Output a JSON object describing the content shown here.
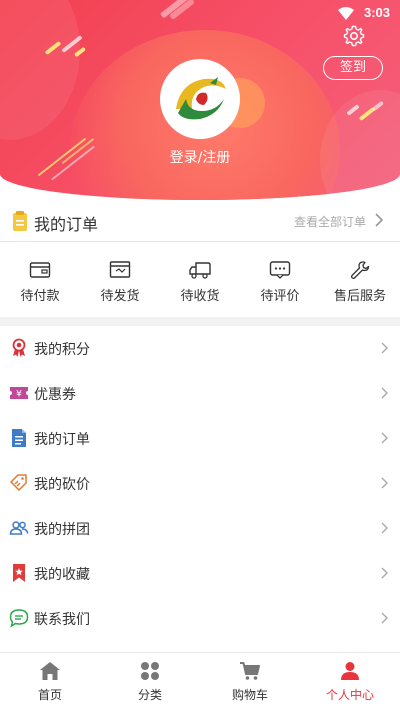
{
  "status_bar": {
    "time": "3:03"
  },
  "header": {
    "checkin_label": "签到",
    "login_label": "登录/注册"
  },
  "orders": {
    "title": "我的订单",
    "view_all": "查看全部订单",
    "statuses": [
      {
        "label": "待付款",
        "icon": "wallet-icon"
      },
      {
        "label": "待发货",
        "icon": "package-icon"
      },
      {
        "label": "待收货",
        "icon": "truck-icon"
      },
      {
        "label": "待评价",
        "icon": "comment-icon"
      },
      {
        "label": "售后服务",
        "icon": "wrench-icon"
      }
    ]
  },
  "menu": {
    "items": [
      {
        "label": "我的积分",
        "icon": "award-icon"
      },
      {
        "label": "优惠券",
        "icon": "coupon-icon"
      },
      {
        "label": "我的订单",
        "icon": "document-icon"
      },
      {
        "label": "我的砍价",
        "icon": "price-tag-icon"
      },
      {
        "label": "我的拼团",
        "icon": "group-icon"
      },
      {
        "label": "我的收藏",
        "icon": "bookmark-icon"
      },
      {
        "label": "联系我们",
        "icon": "chat-icon"
      }
    ]
  },
  "bottom_nav": {
    "items": [
      {
        "label": "首页",
        "icon": "home-icon"
      },
      {
        "label": "分类",
        "icon": "category-icon"
      },
      {
        "label": "购物车",
        "icon": "cart-icon"
      },
      {
        "label": "个人中心",
        "icon": "user-icon",
        "active": true
      }
    ]
  },
  "colors": {
    "header_gradient_start": "#f2404f",
    "header_gradient_end": "#f4617d",
    "accent": "#e8343c",
    "muted_text": "#aaaaaa"
  }
}
